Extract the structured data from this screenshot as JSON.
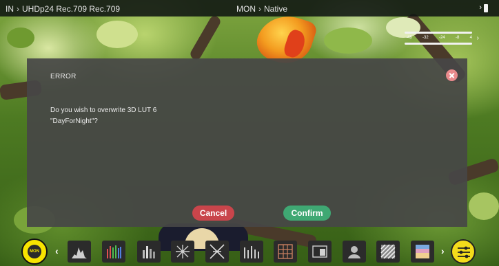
{
  "status_bar": {
    "input_label": "IN",
    "input_format": "UHDp24 Rec.709 Rec.709",
    "monitor_label": "MON",
    "monitor_mode": "Native"
  },
  "audio_meter": {
    "scale": [
      "-48",
      "-32",
      "-24",
      "-8",
      "4"
    ]
  },
  "dialog": {
    "title": "ERROR",
    "message_line1": "Do you wish to overwrite 3D LUT 6",
    "message_line2": "\"DayForNight\"?",
    "cancel_label": "Cancel",
    "confirm_label": "Confirm"
  },
  "toolbar": {
    "mon_label": "MON",
    "tools": [
      "histogram-icon",
      "rgb-parade-icon",
      "luma-waveform-icon",
      "vectorscope-icon",
      "cross-vectorscope-icon",
      "waveform-icon",
      "grid-overlay-icon",
      "anamorphic-icon",
      "focus-peaking-icon",
      "zebra-icon",
      "false-color-icon"
    ]
  },
  "colors": {
    "cancel": "#c9454b",
    "confirm": "#3fa873",
    "close": "#e98a8c",
    "accent_yellow": "#f7e400"
  }
}
